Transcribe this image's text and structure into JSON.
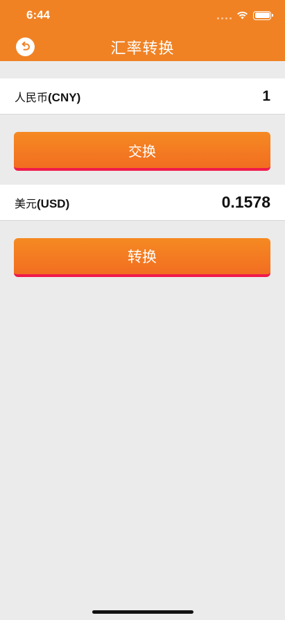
{
  "status_bar": {
    "time": "6:44"
  },
  "nav": {
    "title": "汇率转换",
    "back_icon": "back-arrow-icon"
  },
  "from_currency": {
    "name": "人民币",
    "code": "(CNY)",
    "amount": "1"
  },
  "swap_button": {
    "label": "交换"
  },
  "to_currency": {
    "name": "美元",
    "code": "(USD)",
    "amount": "0.1578"
  },
  "convert_button": {
    "label": "转换"
  },
  "colors": {
    "header": "#f08224",
    "button_top": "#f58a22",
    "button_bottom": "#f26d21",
    "button_border": "#ef1a4c",
    "background": "#ebebeb"
  }
}
